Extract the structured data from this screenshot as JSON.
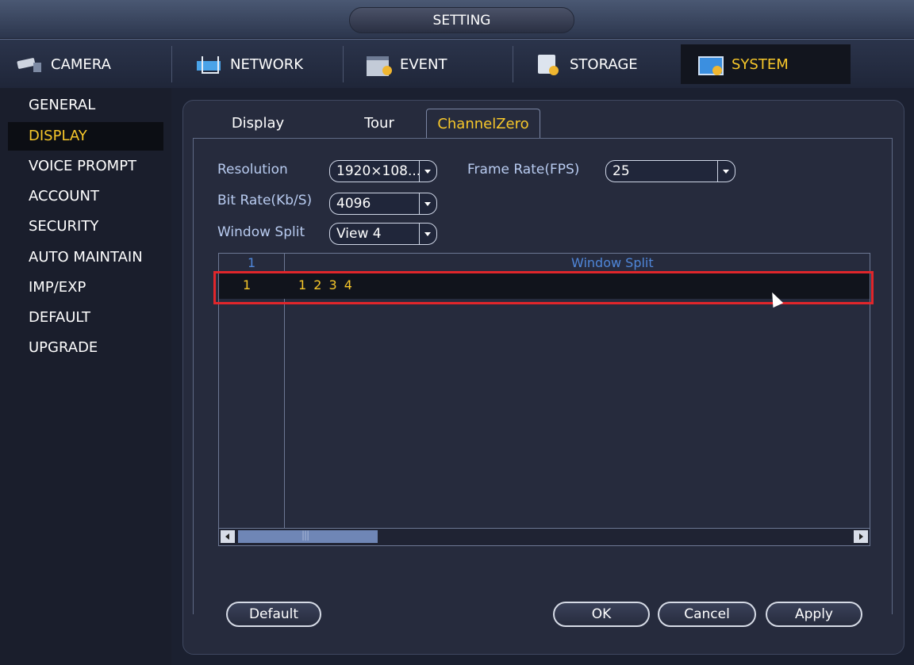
{
  "window": {
    "title": "SETTING"
  },
  "topnav": [
    {
      "label": "CAMERA",
      "icon": "camera-icon"
    },
    {
      "label": "NETWORK",
      "icon": "network-icon"
    },
    {
      "label": "EVENT",
      "icon": "event-icon"
    },
    {
      "label": "STORAGE",
      "icon": "storage-icon"
    },
    {
      "label": "SYSTEM",
      "icon": "system-icon",
      "active": true
    }
  ],
  "sidebar": [
    {
      "label": "GENERAL"
    },
    {
      "label": "DISPLAY",
      "active": true
    },
    {
      "label": "VOICE PROMPT"
    },
    {
      "label": "ACCOUNT"
    },
    {
      "label": "SECURITY"
    },
    {
      "label": "AUTO MAINTAIN"
    },
    {
      "label": "IMP/EXP"
    },
    {
      "label": "DEFAULT"
    },
    {
      "label": "UPGRADE"
    }
  ],
  "subtabs": [
    {
      "label": "Display"
    },
    {
      "label": "Tour"
    },
    {
      "label": "ChannelZero",
      "active": true
    }
  ],
  "form": {
    "resolution_label": "Resolution",
    "resolution_value": "1920×108...",
    "framerate_label": "Frame Rate(FPS)",
    "framerate_value": "25",
    "bitrate_label": "Bit Rate(Kb/S)",
    "bitrate_value": "4096",
    "windowsplit_label": "Window Split",
    "windowsplit_value": "View 4"
  },
  "table": {
    "col_index": "1",
    "col_split": "Window Split",
    "rows": [
      {
        "index": "1",
        "channels": "1 2 3 4"
      }
    ]
  },
  "buttons": {
    "default": "Default",
    "ok": "OK",
    "cancel": "Cancel",
    "apply": "Apply"
  },
  "colors": {
    "accent": "#f7c72a",
    "highlight": "#e0262b",
    "label": "#b8cbf0",
    "header_text": "#4f86d8"
  }
}
